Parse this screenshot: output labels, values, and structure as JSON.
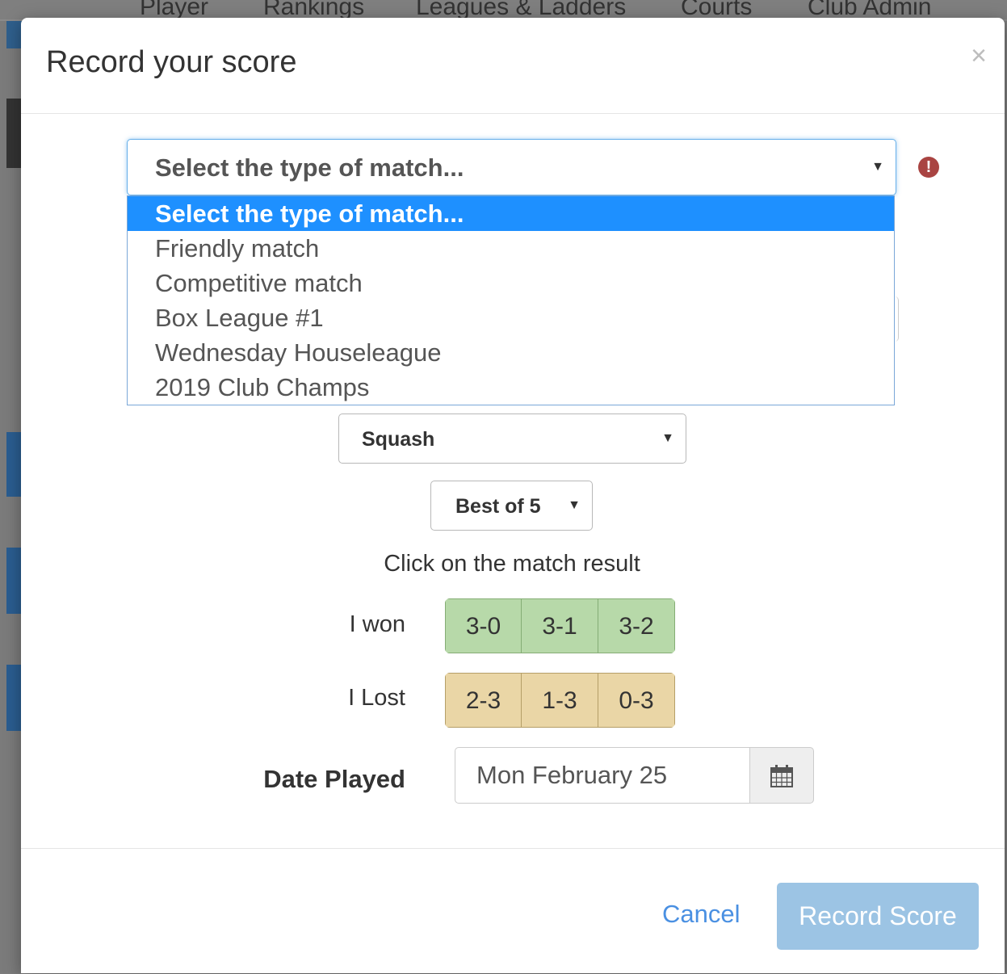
{
  "background": {
    "nav": [
      "Player",
      "Rankings",
      "Leagues & Ladders",
      "Courts",
      "Club Admin"
    ]
  },
  "modal": {
    "title": "Record your score",
    "close_symbol": "×"
  },
  "match_type": {
    "selected": "Select the type of match...",
    "error_symbol": "!",
    "options": [
      "Select the type of match...",
      "Friendly match",
      "Competitive match",
      "Box League #1",
      "Wednesday Houseleague",
      "2019 Club Champs"
    ]
  },
  "sport": {
    "selected": "Squash"
  },
  "format": {
    "selected": "Best of 5"
  },
  "instruction": "Click on the match result",
  "won": {
    "label": "I won",
    "scores": [
      "3-0",
      "3-1",
      "3-2"
    ],
    "color": "#b7d9a9"
  },
  "lost": {
    "label": "I Lost",
    "scores": [
      "2-3",
      "1-3",
      "0-3"
    ],
    "color": "#ead6a6"
  },
  "date": {
    "label": "Date Played",
    "value": "Mon February 25",
    "icon": "calendar-icon"
  },
  "footer": {
    "cancel": "Cancel",
    "record": "Record Score",
    "accent": "#9cc4e4"
  }
}
